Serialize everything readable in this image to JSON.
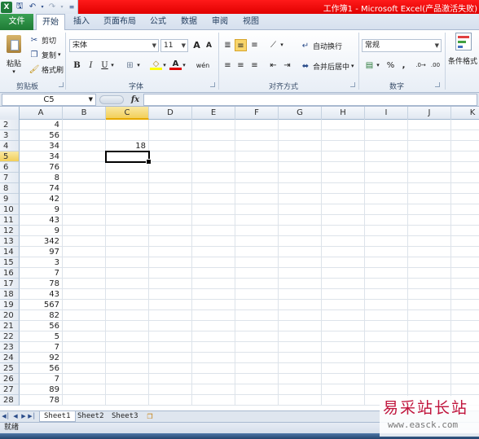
{
  "window": {
    "title": "工作簿1 - Microsoft Excel(产品激活失败)",
    "app_logo": "X",
    "qat_icons": [
      "save-icon",
      "undo-icon",
      "redo-icon",
      "customize-icon"
    ]
  },
  "tabs": [
    "文件",
    "开始",
    "插入",
    "页面布局",
    "公式",
    "数据",
    "审阅",
    "视图"
  ],
  "ribbon": {
    "clipboard": {
      "paste": "粘贴",
      "cut": "剪切",
      "copy": "复制",
      "format_painter": "格式刷",
      "label": "剪贴板"
    },
    "font": {
      "name": "宋体",
      "size": "11",
      "bold": "B",
      "italic": "I",
      "underline": "U",
      "grow": "A",
      "shrink": "A",
      "phonetic": "wén",
      "label": "字体"
    },
    "alignment": {
      "wrap": "自动换行",
      "merge": "合并后居中",
      "label": "对齐方式"
    },
    "number": {
      "format": "常规",
      "percent": "%",
      "comma": ",",
      "label": "数字"
    },
    "styles": {
      "conditional": "条件格式"
    }
  },
  "formula_bar": {
    "name_box": "C5",
    "fx": "fx",
    "value": ""
  },
  "columns": [
    "A",
    "B",
    "C",
    "D",
    "E",
    "F",
    "G",
    "H",
    "I",
    "J",
    "K"
  ],
  "selected_column": "C",
  "rows": [
    {
      "n": "2",
      "a": "4",
      "c": ""
    },
    {
      "n": "3",
      "a": "56",
      "c": ""
    },
    {
      "n": "4",
      "a": "34",
      "c": "18"
    },
    {
      "n": "5",
      "a": "34",
      "c": ""
    },
    {
      "n": "6",
      "a": "76",
      "c": ""
    },
    {
      "n": "7",
      "a": "8",
      "c": ""
    },
    {
      "n": "8",
      "a": "74",
      "c": ""
    },
    {
      "n": "9",
      "a": "42",
      "c": ""
    },
    {
      "n": "10",
      "a": "9",
      "c": ""
    },
    {
      "n": "11",
      "a": "43",
      "c": ""
    },
    {
      "n": "12",
      "a": "9",
      "c": ""
    },
    {
      "n": "13",
      "a": "342",
      "c": ""
    },
    {
      "n": "14",
      "a": "97",
      "c": ""
    },
    {
      "n": "15",
      "a": "3",
      "c": ""
    },
    {
      "n": "16",
      "a": "7",
      "c": ""
    },
    {
      "n": "17",
      "a": "78",
      "c": ""
    },
    {
      "n": "18",
      "a": "43",
      "c": ""
    },
    {
      "n": "19",
      "a": "567",
      "c": ""
    },
    {
      "n": "20",
      "a": "82",
      "c": ""
    },
    {
      "n": "21",
      "a": "56",
      "c": ""
    },
    {
      "n": "22",
      "a": "5",
      "c": ""
    },
    {
      "n": "23",
      "a": "7",
      "c": ""
    },
    {
      "n": "24",
      "a": "92",
      "c": ""
    },
    {
      "n": "25",
      "a": "56",
      "c": ""
    },
    {
      "n": "26",
      "a": "7",
      "c": ""
    },
    {
      "n": "27",
      "a": "89",
      "c": ""
    },
    {
      "n": "28",
      "a": "78",
      "c": ""
    }
  ],
  "selected_row": "5",
  "sheets": [
    "Sheet1",
    "Sheet2",
    "Sheet3"
  ],
  "active_sheet": "Sheet1",
  "status": "就绪",
  "watermark": {
    "text": "易采站长站",
    "url": "www.easck.com"
  },
  "colors": {
    "title_bar": "#e00000",
    "file_tab": "#1f7b35",
    "selection": "#f2cf5a"
  }
}
